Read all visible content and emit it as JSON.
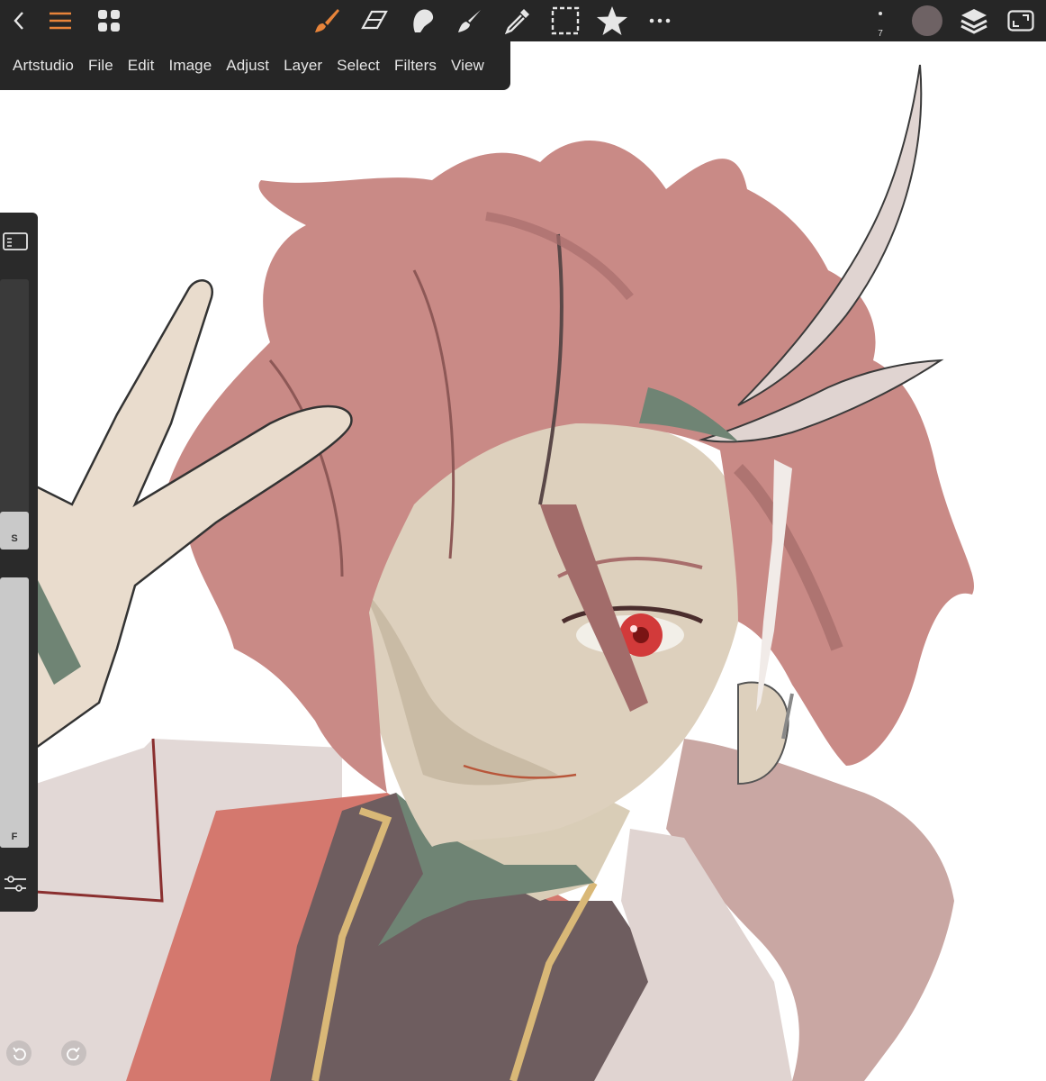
{
  "toolbar": {
    "icons": [
      "back-icon",
      "menu-icon",
      "gallery-icon",
      "brush-icon",
      "eraser-icon",
      "smudge-icon",
      "blend-icon",
      "eyedropper-icon",
      "selection-icon",
      "favorites-icon",
      "more-icon",
      "color-swatch",
      "layers-icon",
      "fullscreen-icon"
    ],
    "brush_size_value": "7",
    "current_color": "#6e6264",
    "accent_color": "#e8843a"
  },
  "menu": {
    "items": [
      "Artstudio",
      "File",
      "Edit",
      "Image",
      "Adjust",
      "Layer",
      "Select",
      "Filters",
      "View"
    ]
  },
  "left_panel": {
    "size_slider_label": "S",
    "flow_slider_label": "F",
    "size_level": 0.0,
    "flow_level": 1.0
  },
  "colors": {
    "hair": "#c98a86",
    "hair_shadow": "#a86e6c",
    "skin": "#ddd0bd",
    "skin_shadow": "#6f8474",
    "jacket_red": "#d37a70",
    "coat_light": "#e0d4d1",
    "eye": "#d23a3a"
  }
}
